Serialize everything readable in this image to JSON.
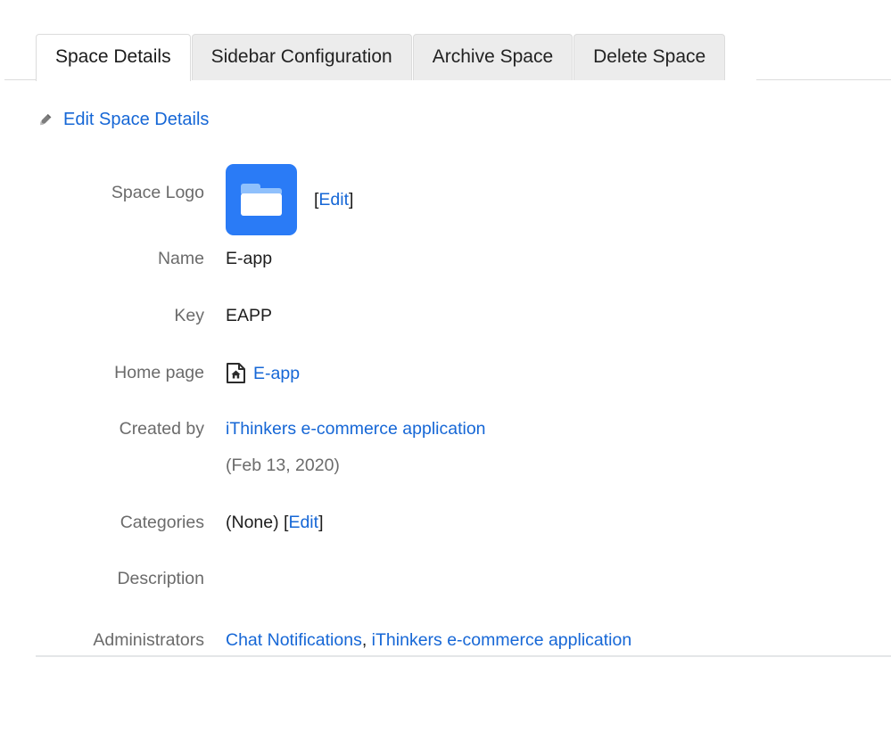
{
  "tabs": [
    {
      "label": "Space Details",
      "active": true
    },
    {
      "label": "Sidebar Configuration",
      "active": false
    },
    {
      "label": "Archive Space",
      "active": false
    },
    {
      "label": "Delete Space",
      "active": false
    }
  ],
  "edit_action": {
    "icon": "pencil-icon",
    "label": "Edit Space Details"
  },
  "details": {
    "labels": {
      "space_logo": "Space Logo",
      "name": "Name",
      "key": "Key",
      "home_page": "Home page",
      "created_by": "Created by",
      "categories": "Categories",
      "description": "Description",
      "administrators": "Administrators"
    },
    "space_logo": {
      "icon": "folder-icon",
      "edit_open_bracket": "[",
      "edit_label": "Edit",
      "edit_close_bracket": "]"
    },
    "name": "E-app",
    "key": "EAPP",
    "home_page": {
      "icon": "page-home-icon",
      "label": "E-app"
    },
    "created_by": {
      "user": "iThinkers e-commerce application",
      "date": "(Feb 13, 2020)"
    },
    "categories": {
      "value": "(None)",
      "edit_open_bracket": "[",
      "edit_label": "Edit",
      "edit_close_bracket": "]"
    },
    "description": "",
    "administrators": {
      "first": "Chat Notifications",
      "separator": ",",
      "second": "iThinkers e-commerce application"
    }
  },
  "colors": {
    "link": "#1667d6",
    "label": "#6b6b6b",
    "value": "#1d1d1d",
    "logo_background": "#2a7bf6",
    "tab_inactive_background": "#ececec",
    "border": "#dcdcdc"
  }
}
